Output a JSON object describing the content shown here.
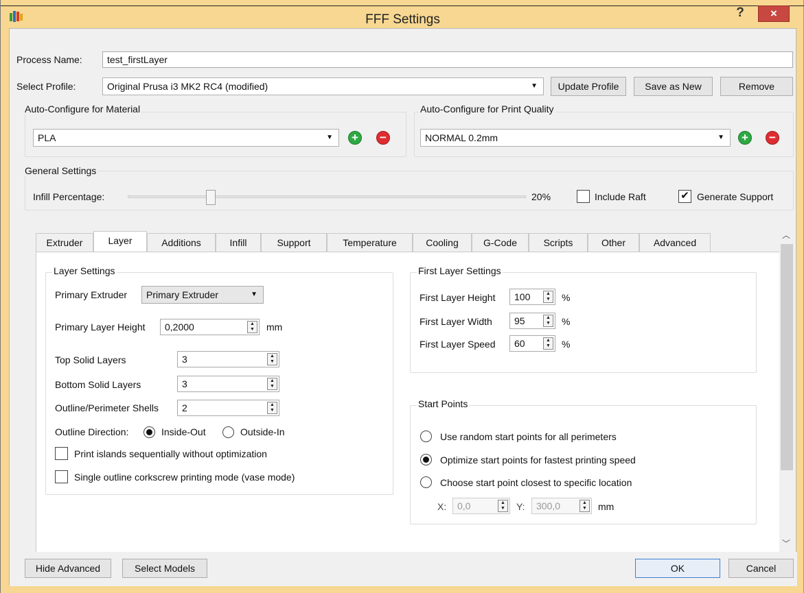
{
  "window": {
    "title": "FFF Settings",
    "help_glyph": "?",
    "close_glyph": "×"
  },
  "process": {
    "label": "Process Name:",
    "value": "test_firstLayer"
  },
  "profile": {
    "label": "Select Profile:",
    "value": "Original Prusa i3 MK2 RC4 (modified)",
    "update": "Update Profile",
    "save_new": "Save as New",
    "remove": "Remove"
  },
  "material": {
    "title": "Auto-Configure for Material",
    "value": "PLA"
  },
  "quality": {
    "title": "Auto-Configure for Print Quality",
    "value": "NORMAL 0.2mm"
  },
  "general": {
    "title": "General Settings",
    "infill_label": "Infill Percentage:",
    "infill_value": "20%",
    "infill_fraction": 0.2,
    "raft_label": "Include Raft",
    "raft_checked": false,
    "support_label": "Generate Support",
    "support_checked": true
  },
  "tabs": [
    "Extruder",
    "Layer",
    "Additions",
    "Infill",
    "Support",
    "Temperature",
    "Cooling",
    "G-Code",
    "Scripts",
    "Other",
    "Advanced"
  ],
  "active_tab": "Layer",
  "layer": {
    "title": "Layer Settings",
    "primary_extruder_label": "Primary Extruder",
    "primary_extruder_value": "Primary Extruder",
    "layer_height_label": "Primary Layer Height",
    "layer_height_value": "0,2000",
    "layer_height_unit": "mm",
    "top_label": "Top Solid Layers",
    "top_value": "3",
    "bottom_label": "Bottom Solid Layers",
    "bottom_value": "3",
    "shells_label": "Outline/Perimeter Shells",
    "shells_value": "2",
    "direction_label": "Outline Direction:",
    "inside_out": "Inside-Out",
    "outside_in": "Outside-In",
    "islands_label": "Print islands sequentially without optimization",
    "vase_label": "Single outline corkscrew printing mode (vase mode)"
  },
  "first_layer": {
    "title": "First Layer Settings",
    "height_label": "First Layer Height",
    "height_value": "100",
    "width_label": "First Layer Width",
    "width_value": "95",
    "speed_label": "First Layer Speed",
    "speed_value": "60",
    "unit": "%"
  },
  "start_points": {
    "title": "Start Points",
    "option_random": "Use random start points for all perimeters",
    "option_optimize": "Optimize start points for fastest printing speed",
    "option_closest": "Choose start point closest to specific location",
    "x_label": "X:",
    "x_value": "0,0",
    "y_label": "Y:",
    "y_value": "300,0",
    "unit": "mm"
  },
  "footer": {
    "hide_advanced": "Hide Advanced",
    "select_models": "Select Models",
    "ok": "OK",
    "cancel": "Cancel"
  }
}
